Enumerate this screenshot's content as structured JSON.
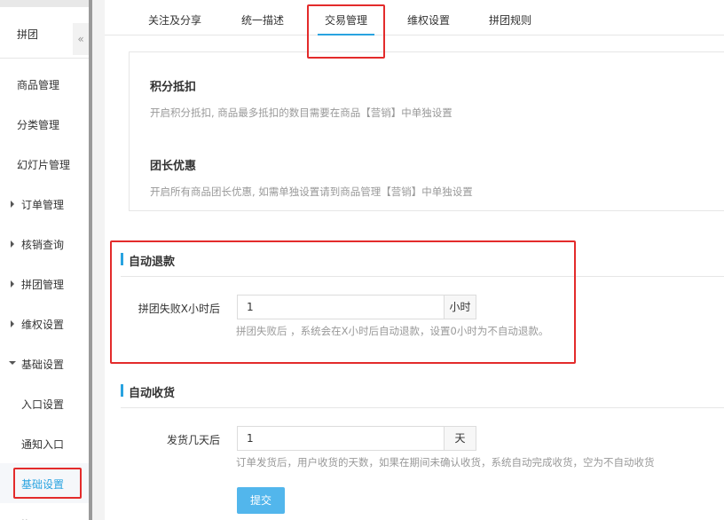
{
  "sidebar": {
    "title": "拼团",
    "collapse_glyph": "«",
    "items": [
      {
        "label": "商品管理"
      },
      {
        "label": "分类管理"
      },
      {
        "label": "幻灯片管理"
      },
      {
        "label": "订单管理"
      },
      {
        "label": "核销查询"
      },
      {
        "label": "拼团管理"
      },
      {
        "label": "维权设置"
      },
      {
        "label": "基础设置"
      },
      {
        "label": "入口设置"
      },
      {
        "label": "通知入口"
      },
      {
        "label": "基础设置"
      }
    ]
  },
  "tabs": [
    {
      "label": "关注及分享"
    },
    {
      "label": "统一描述"
    },
    {
      "label": "交易管理"
    },
    {
      "label": "维权设置"
    },
    {
      "label": "拼团规则"
    }
  ],
  "panel": {
    "points_title": "积分抵扣",
    "points_desc": "开启积分抵扣, 商品最多抵扣的数目需要在商品【营销】中单独设置",
    "leader_title": "团长优惠",
    "leader_desc": "开启所有商品团长优惠, 如需单独设置请到商品管理【营销】中单独设置"
  },
  "auto_refund": {
    "title": "自动退款",
    "label": "拼团失败X小时后",
    "value": "1",
    "unit": "小时",
    "help": "拼团失败后 ，系统会在X小时后自动退款，设置0小时为不自动退款。"
  },
  "auto_receive": {
    "title": "自动收货",
    "label": "发货几天后",
    "value": "1",
    "unit": "天",
    "help": "订单发货后，用户收货的天数，如果在期间未确认收货，系统自动完成收货，空为不自动收货"
  },
  "submit_label": "提交",
  "colors": {
    "accent": "#29a3e0",
    "highlight_box": "#e32b2b",
    "button": "#52b6ec"
  }
}
